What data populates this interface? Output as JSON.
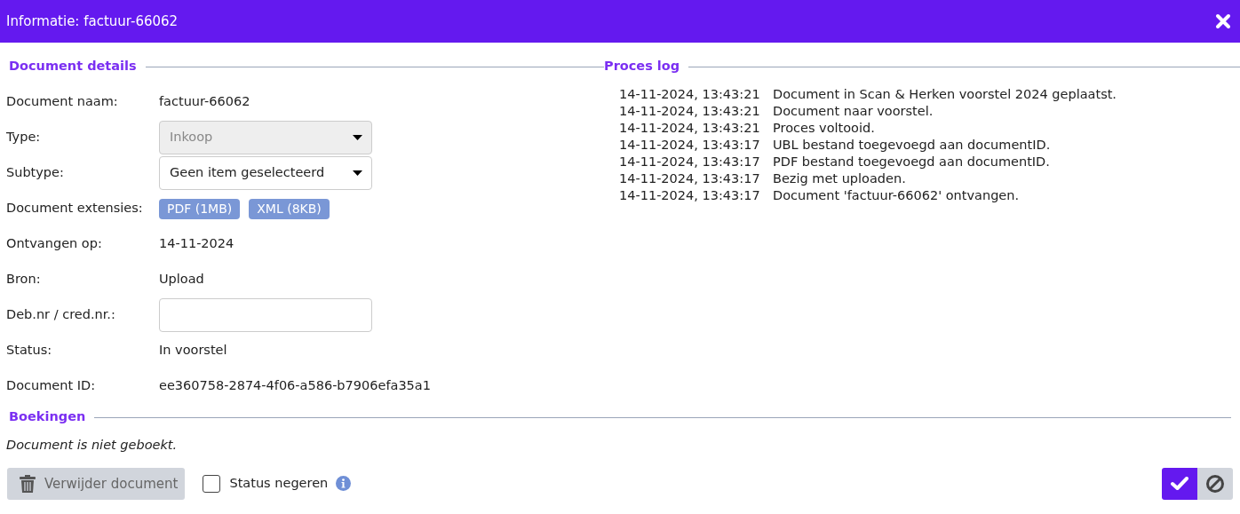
{
  "window": {
    "title": "Informatie: factuur-66062"
  },
  "details": {
    "heading": "Document details",
    "fields": [
      {
        "kind": "text",
        "label": "Document naam:",
        "value": "factuur-66062"
      },
      {
        "kind": "select",
        "label": "Type:",
        "value": "Inkoop",
        "disabled": true
      },
      {
        "kind": "select",
        "label": "Subtype:",
        "value": "Geen item geselecteerd",
        "disabled": false
      },
      {
        "kind": "tags",
        "label": "Document extensies:",
        "tags": [
          "PDF (1MB)",
          "XML (8KB)"
        ]
      },
      {
        "kind": "text",
        "label": "Ontvangen op:",
        "value": "14-11-2024"
      },
      {
        "kind": "text",
        "label": "Bron:",
        "value": "Upload"
      },
      {
        "kind": "input",
        "label": "Deb.nr / cred.nr.:"
      },
      {
        "kind": "text",
        "label": "Status:",
        "value": "In voorstel"
      },
      {
        "kind": "text",
        "label": "Document ID:",
        "value": "ee360758-2874-4f06-a586-b7906efa35a1"
      }
    ]
  },
  "log": {
    "heading": "Proces log",
    "entries": [
      {
        "time": "14-11-2024, 13:43:21",
        "message": "Document in Scan & Herken voorstel 2024 geplaatst."
      },
      {
        "time": "14-11-2024, 13:43:21",
        "message": "Document naar voorstel."
      },
      {
        "time": "14-11-2024, 13:43:21",
        "message": "Proces voltooid."
      },
      {
        "time": "14-11-2024, 13:43:17",
        "message": "UBL bestand toegevoegd aan documentID."
      },
      {
        "time": "14-11-2024, 13:43:17",
        "message": "PDF bestand toegevoegd aan documentID."
      },
      {
        "time": "14-11-2024, 13:43:17",
        "message": "Bezig met uploaden."
      },
      {
        "time": "14-11-2024, 13:43:17",
        "message": "Document 'factuur-66062' ontvangen."
      }
    ]
  },
  "bookings": {
    "heading": "Boekingen",
    "note": "Document is niet geboekt."
  },
  "footer": {
    "delete_button": {
      "label": "Verwijder document",
      "disabled": true
    },
    "ignore_status": {
      "label": "Status negeren",
      "checked": false
    }
  }
}
